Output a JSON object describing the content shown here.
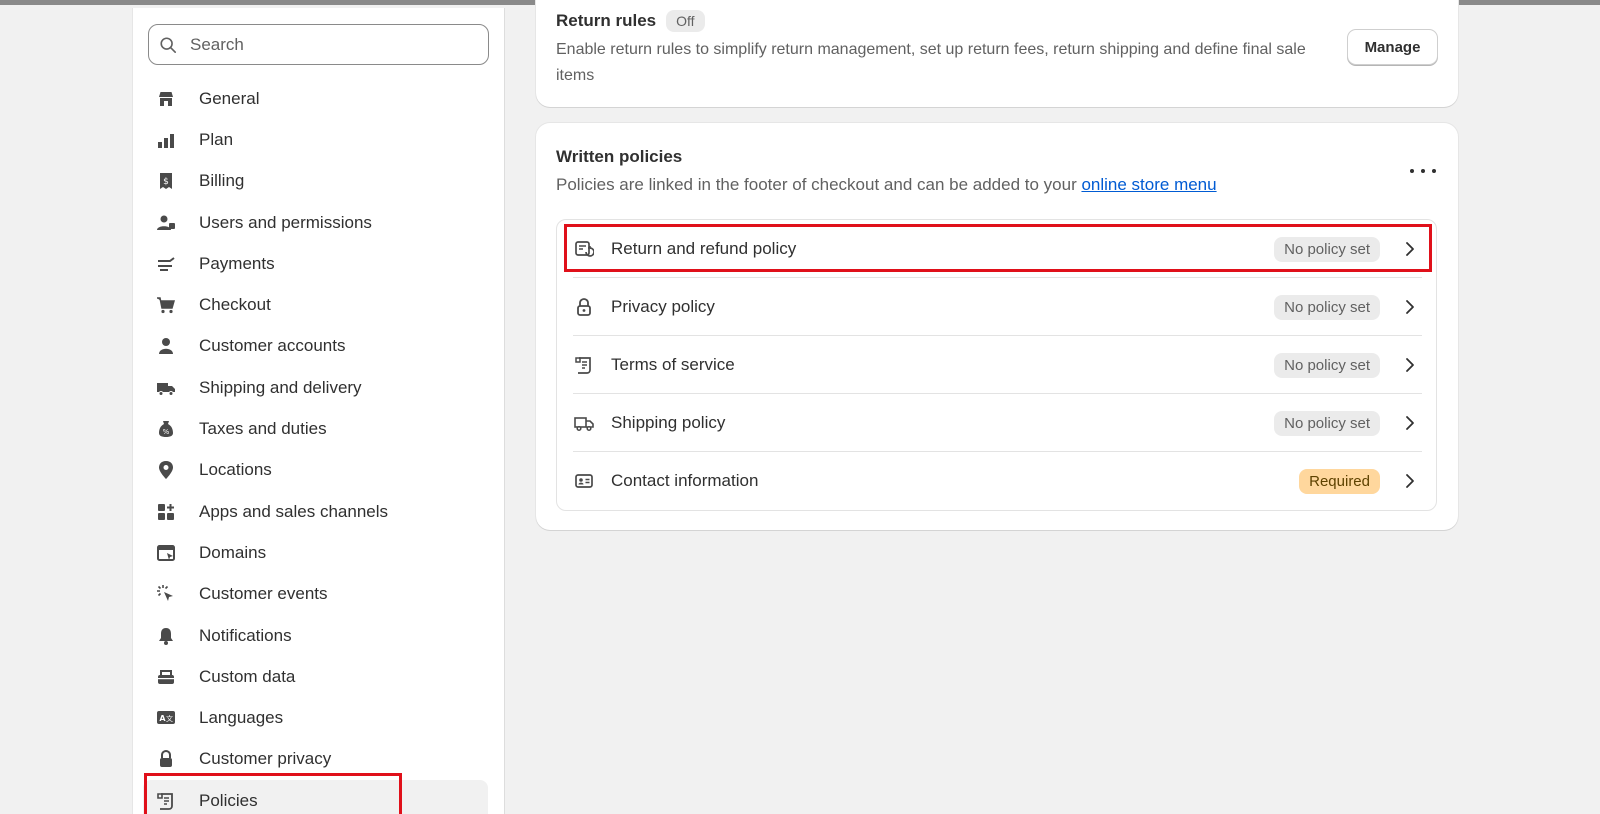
{
  "search": {
    "placeholder": "Search"
  },
  "sidebar": {
    "items": [
      {
        "label": "General",
        "icon": "store-icon"
      },
      {
        "label": "Plan",
        "icon": "plan-icon"
      },
      {
        "label": "Billing",
        "icon": "billing-icon"
      },
      {
        "label": "Users and permissions",
        "icon": "users-icon"
      },
      {
        "label": "Payments",
        "icon": "payments-icon"
      },
      {
        "label": "Checkout",
        "icon": "cart-icon"
      },
      {
        "label": "Customer accounts",
        "icon": "person-icon"
      },
      {
        "label": "Shipping and delivery",
        "icon": "truck-icon"
      },
      {
        "label": "Taxes and duties",
        "icon": "tax-icon"
      },
      {
        "label": "Locations",
        "icon": "location-icon"
      },
      {
        "label": "Apps and sales channels",
        "icon": "apps-icon"
      },
      {
        "label": "Domains",
        "icon": "domains-icon"
      },
      {
        "label": "Customer events",
        "icon": "cursor-click-icon"
      },
      {
        "label": "Notifications",
        "icon": "bell-icon"
      },
      {
        "label": "Custom data",
        "icon": "database-icon"
      },
      {
        "label": "Languages",
        "icon": "language-icon"
      },
      {
        "label": "Customer privacy",
        "icon": "lock-icon"
      },
      {
        "label": "Policies",
        "icon": "scroll-icon",
        "active": true
      }
    ]
  },
  "return_rules": {
    "title": "Return rules",
    "badge": "Off",
    "description": "Enable return rules to simplify return management, set up return fees, return shipping and define final sale items",
    "manage_label": "Manage"
  },
  "written_policies": {
    "title": "Written policies",
    "description_prefix": "Policies are linked in the footer of checkout and can be added to your ",
    "link_text": "online store menu",
    "rows": [
      {
        "label": "Return and refund policy",
        "status": "No policy set",
        "icon": "return-icon"
      },
      {
        "label": "Privacy policy",
        "status": "No policy set",
        "icon": "lock-icon"
      },
      {
        "label": "Terms of service",
        "status": "No policy set",
        "icon": "scroll-icon"
      },
      {
        "label": "Shipping policy",
        "status": "No policy set",
        "icon": "truck-icon"
      },
      {
        "label": "Contact information",
        "status": "Required",
        "icon": "contact-card-icon"
      }
    ]
  },
  "colors": {
    "highlight": "#e0101a",
    "link": "#005bd3",
    "required_badge": "#ffd79d"
  }
}
